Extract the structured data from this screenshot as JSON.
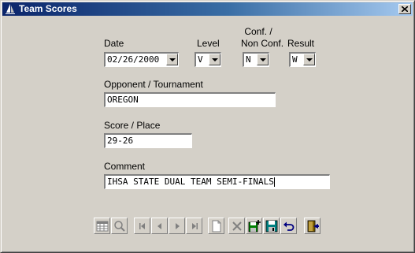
{
  "window": {
    "title": "Team Scores",
    "close_label": "×"
  },
  "form": {
    "date_label": "Date",
    "date_value": "02/26/2000",
    "level_label": "Level",
    "level_value": "V",
    "conf_label_line1": "Conf. /",
    "conf_label_line2": "Non Conf.",
    "conf_value": "N",
    "result_label": "Result",
    "result_value": "W",
    "opponent_label": "Opponent / Tournament",
    "opponent_value": "OREGON",
    "score_label": "Score / Place",
    "score_value": "29-26",
    "comment_label": "Comment",
    "comment_value": "IHSA STATE DUAL TEAM SEMI-FINALS"
  },
  "toolbar": {
    "icons": [
      "table-view-icon",
      "search-icon",
      "first-record-icon",
      "prev-record-icon",
      "next-record-icon",
      "last-record-icon",
      "new-record-icon",
      "delete-icon",
      "add-record-icon",
      "save-icon",
      "undo-icon",
      "exit-icon"
    ]
  }
}
